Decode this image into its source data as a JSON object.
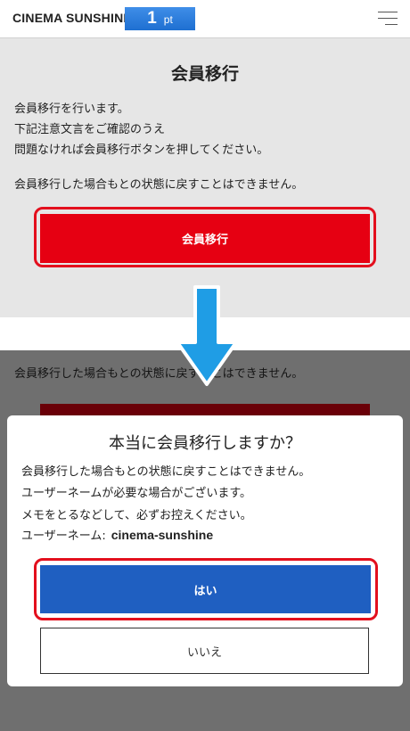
{
  "header": {
    "logo": "CINEMA SUNSHINE",
    "points_value": "1",
    "points_unit": "pt",
    "menu_icon": "hamburger-menu-icon"
  },
  "top": {
    "title": "会員移行",
    "lines": [
      "会員移行を行います。",
      "下記注意文言をご確認のうえ",
      "問題なければ会員移行ボタンを押してください。"
    ],
    "warning": "会員移行した場合もとの状態に戻すことはできません。",
    "button_label": "会員移行"
  },
  "bottom": {
    "background_text": "会員移行した場合もとの状態に戻すことはできません。",
    "modal": {
      "title": "本当に会員移行しますか？",
      "lines": [
        "会員移行した場合もとの状態に戻すことはできません。",
        "ユーザーネームが必要な場合がございます。",
        "メモをとるなどして、必ずお控えください。"
      ],
      "username_label": "ユーザーネーム:",
      "username": "cinema-sunshine",
      "yes_label": "はい",
      "no_label": "いいえ"
    }
  },
  "colors": {
    "brand_red": "#e60012",
    "confirm_blue": "#1f5fc1",
    "points_blue": "#2a7ad9",
    "arrow_blue": "#1f9de5",
    "highlight_red": "#e30f1d"
  }
}
